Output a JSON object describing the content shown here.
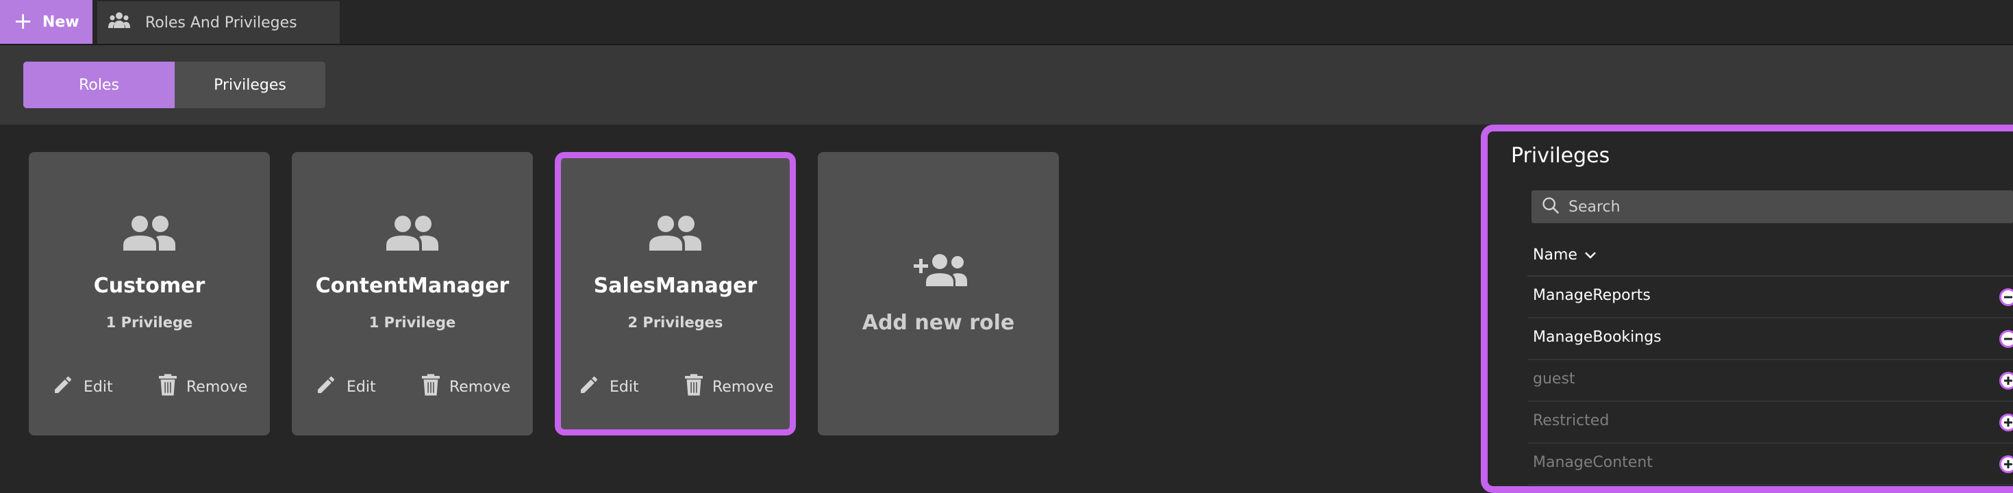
{
  "tabbar": {
    "new_label": "New",
    "tab_title": "Roles And Privileges",
    "tab_icon": "group-icon"
  },
  "toolbar": {
    "segments": [
      {
        "label": "Roles",
        "active": true
      },
      {
        "label": "Privileges",
        "active": false
      }
    ]
  },
  "roles": [
    {
      "name": "Customer",
      "count": "1 Privilege",
      "edit": "Edit",
      "remove": "Remove",
      "selected": false
    },
    {
      "name": "ContentManager",
      "count": "1 Privilege",
      "edit": "Edit",
      "remove": "Remove",
      "selected": false
    },
    {
      "name": "SalesManager",
      "count": "2 Privileges",
      "edit": "Edit",
      "remove": "Remove",
      "selected": true
    }
  ],
  "add_role": {
    "label": "Add new role",
    "icon": "add-group-icon"
  },
  "privileges_panel": {
    "title": "Privileges",
    "search_placeholder": "Search",
    "column_header": "Name",
    "items": [
      {
        "name": "ManageReports",
        "assigned": true
      },
      {
        "name": "ManageBookings",
        "assigned": true
      },
      {
        "name": "guest",
        "assigned": false
      },
      {
        "name": "Restricted",
        "assigned": false
      },
      {
        "name": "ManageContent",
        "assigned": false
      }
    ]
  },
  "colors": {
    "accent": "#b57de0",
    "selection_border": "#c663ee",
    "background": "#262626",
    "card": "#505050"
  }
}
